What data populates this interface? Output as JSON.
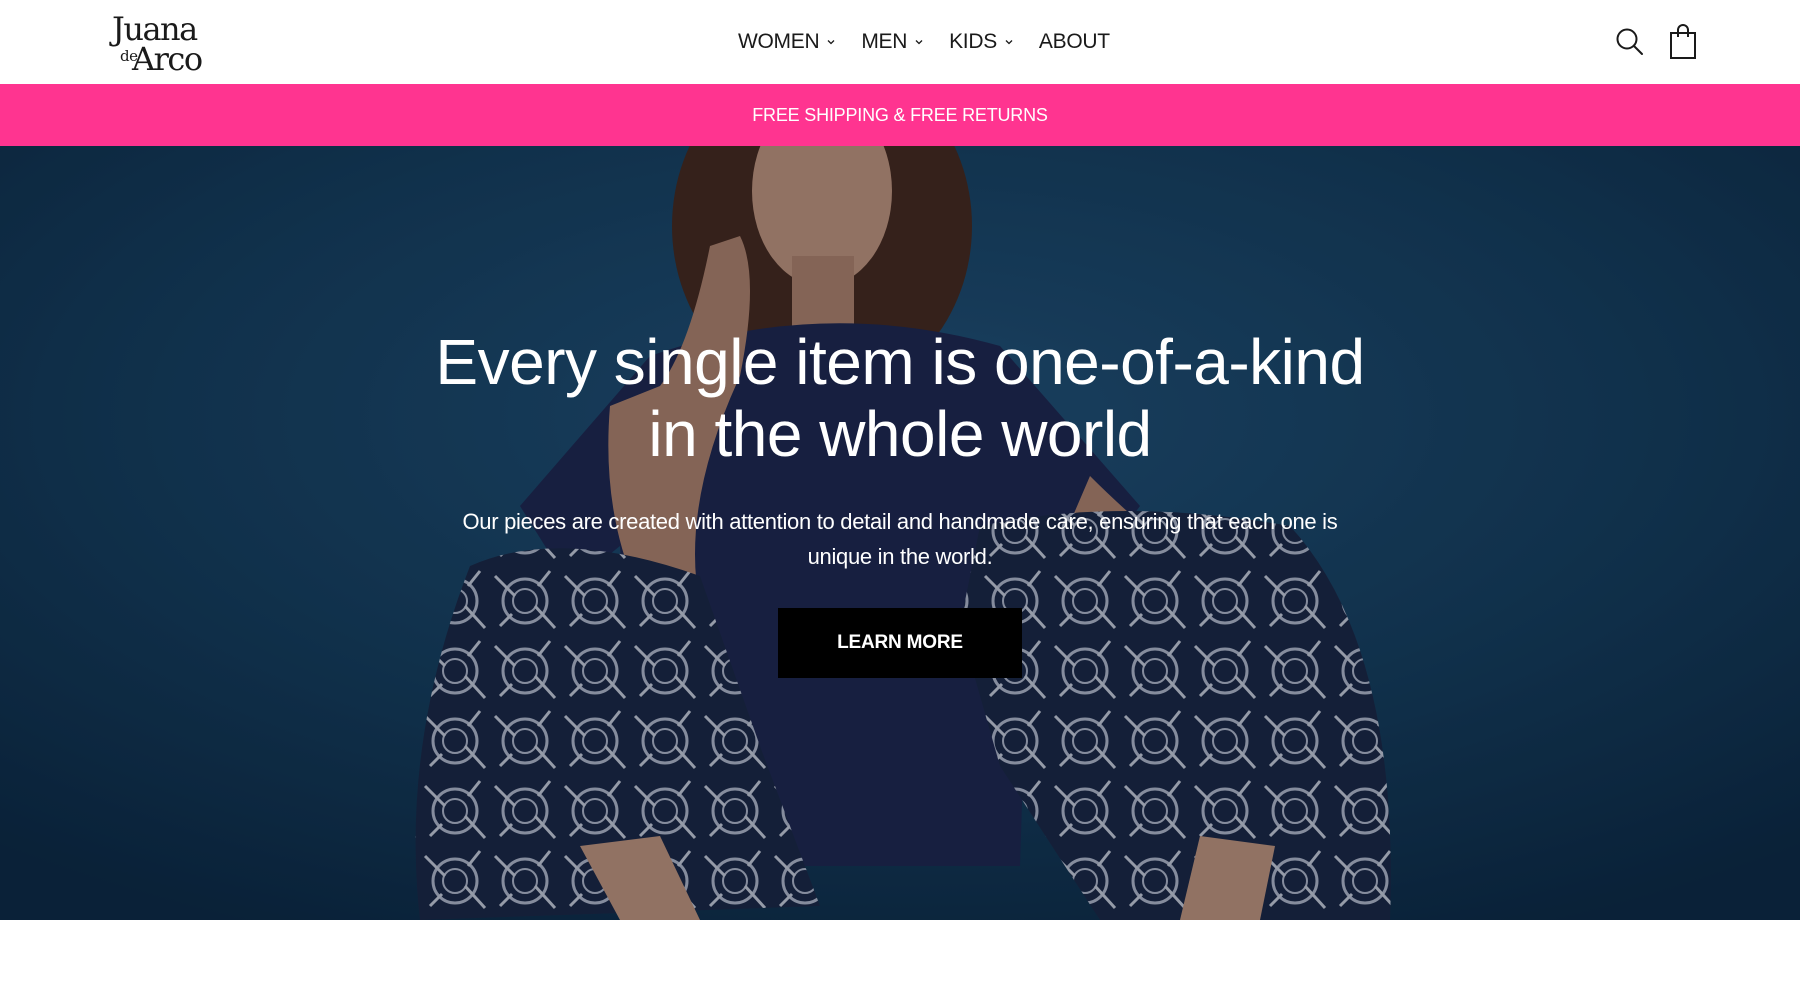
{
  "header": {
    "logo": {
      "line1": "Juana",
      "line2": "de",
      "line3": "Arco"
    },
    "nav": [
      {
        "label": "WOMEN",
        "has_dropdown": true
      },
      {
        "label": "MEN",
        "has_dropdown": true
      },
      {
        "label": "KIDS",
        "has_dropdown": true
      },
      {
        "label": "ABOUT",
        "has_dropdown": false
      }
    ],
    "icons": {
      "search": "search-icon",
      "cart": "shopping-bag-icon"
    }
  },
  "announcement": {
    "text": "FREE SHIPPING & FREE RETURNS",
    "background": "#ff3490"
  },
  "hero": {
    "title_line1": "Every single item is one-of-a-kind",
    "title_line2": "in the whole world",
    "subtitle": "Our pieces are created with attention to detail and handmade care, ensuring that each one is unique in the world.",
    "cta_label": "LEARN MORE",
    "background": "#153a5a"
  }
}
